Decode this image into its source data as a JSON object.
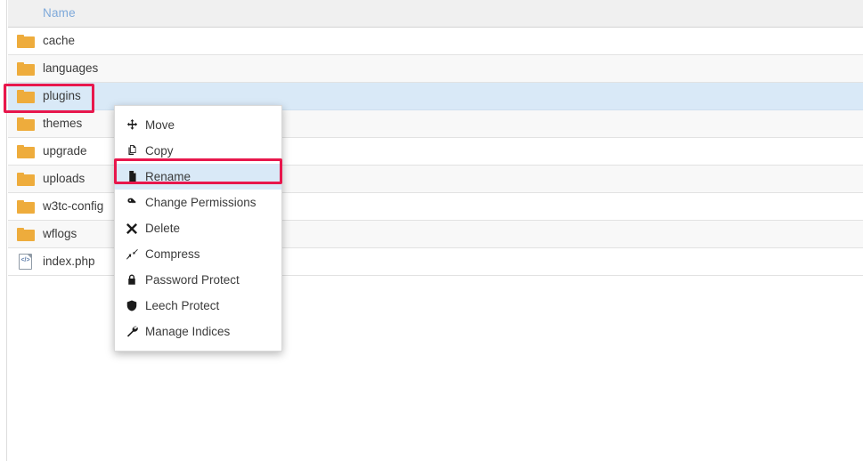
{
  "file_manager": {
    "columns": [
      "Name"
    ],
    "rows": [
      {
        "name": "cache",
        "icon": "folder-icon",
        "selected": false
      },
      {
        "name": "languages",
        "icon": "folder-icon",
        "selected": false
      },
      {
        "name": "plugins",
        "icon": "folder-icon",
        "selected": true
      },
      {
        "name": "themes",
        "icon": "folder-icon",
        "selected": false
      },
      {
        "name": "upgrade",
        "icon": "folder-icon",
        "selected": false
      },
      {
        "name": "uploads",
        "icon": "folder-icon",
        "selected": false
      },
      {
        "name": "w3tc-config",
        "icon": "folder-icon",
        "selected": false
      },
      {
        "name": "wflogs",
        "icon": "folder-icon",
        "selected": false
      },
      {
        "name": "index.php",
        "icon": "php-file-icon",
        "selected": false
      }
    ],
    "file_icon_glyph": "</>"
  },
  "context_menu": {
    "items": [
      {
        "label": "Move",
        "icon": "move-arrows-icon",
        "highlighted": false
      },
      {
        "label": "Copy",
        "icon": "copy-pages-icon",
        "highlighted": false
      },
      {
        "label": "Rename",
        "icon": "file-icon",
        "highlighted": true
      },
      {
        "label": "Change Permissions",
        "icon": "key-icon",
        "highlighted": false
      },
      {
        "label": "Delete",
        "icon": "x-mark-icon",
        "highlighted": false
      },
      {
        "label": "Compress",
        "icon": "compress-arrows-icon",
        "highlighted": false
      },
      {
        "label": "Password Protect",
        "icon": "lock-icon",
        "highlighted": false
      },
      {
        "label": "Leech Protect",
        "icon": "shield-icon",
        "highlighted": false
      },
      {
        "label": "Manage Indices",
        "icon": "wrench-icon",
        "highlighted": false
      }
    ]
  },
  "annotations": {
    "highlight_color": "#e8174c",
    "selected_row_color": "#d9e9f7",
    "folder_color": "#eeac3c",
    "header_text_color": "#7ea9da",
    "targets": [
      "plugins",
      "Rename"
    ]
  }
}
